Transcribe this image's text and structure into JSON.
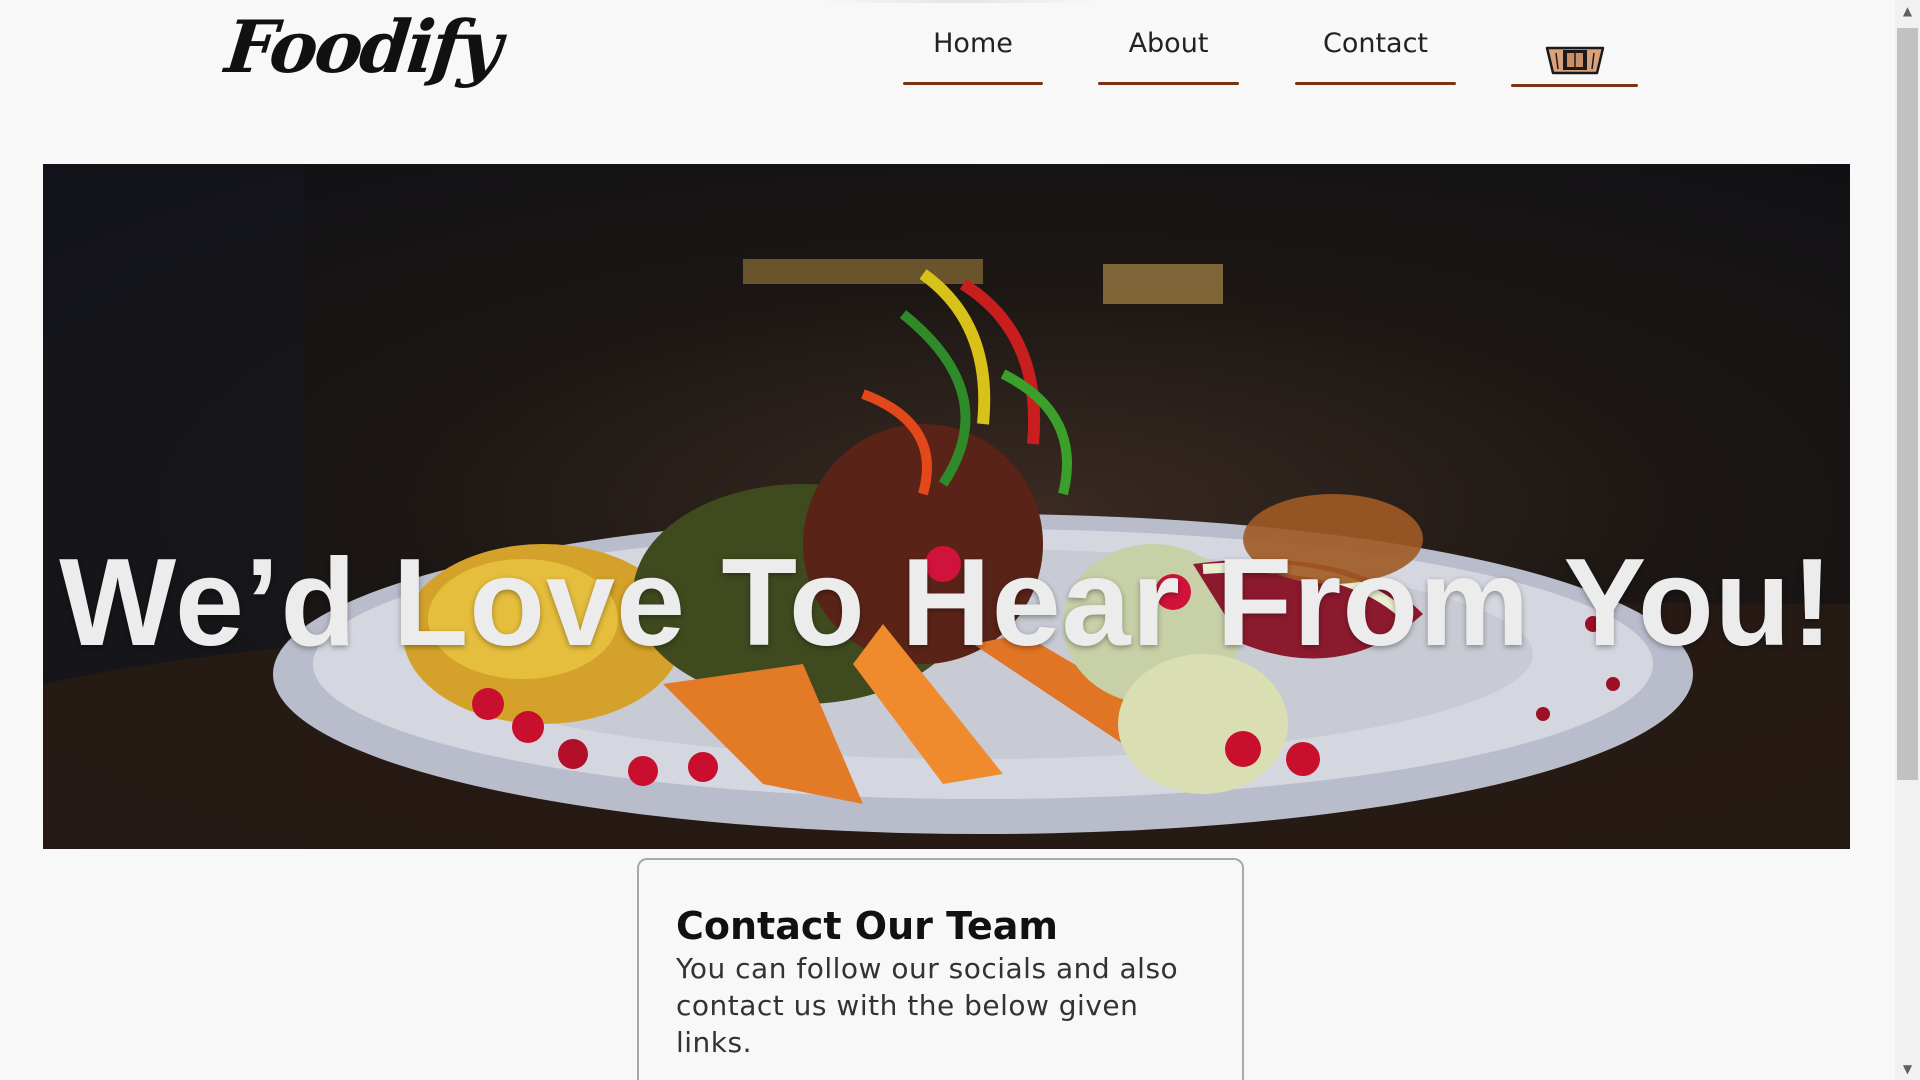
{
  "brand": {
    "logo_text": "Foodify"
  },
  "nav": {
    "items": [
      {
        "label": "Home"
      },
      {
        "label": "About"
      },
      {
        "label": "Contact"
      }
    ],
    "cart_icon": "cart-icon"
  },
  "hero": {
    "title": "We’d Love To Hear From You!"
  },
  "contact_card": {
    "title": "Contact Our Team",
    "text": "You can follow our socials and also contact us with the below given links."
  },
  "scrollbar": {
    "up_icon": "▲",
    "down_icon": "▼"
  },
  "colors": {
    "nav_underline": "#7a3415",
    "page_background": "#f8f8f8",
    "hero_text": "#ececec"
  }
}
